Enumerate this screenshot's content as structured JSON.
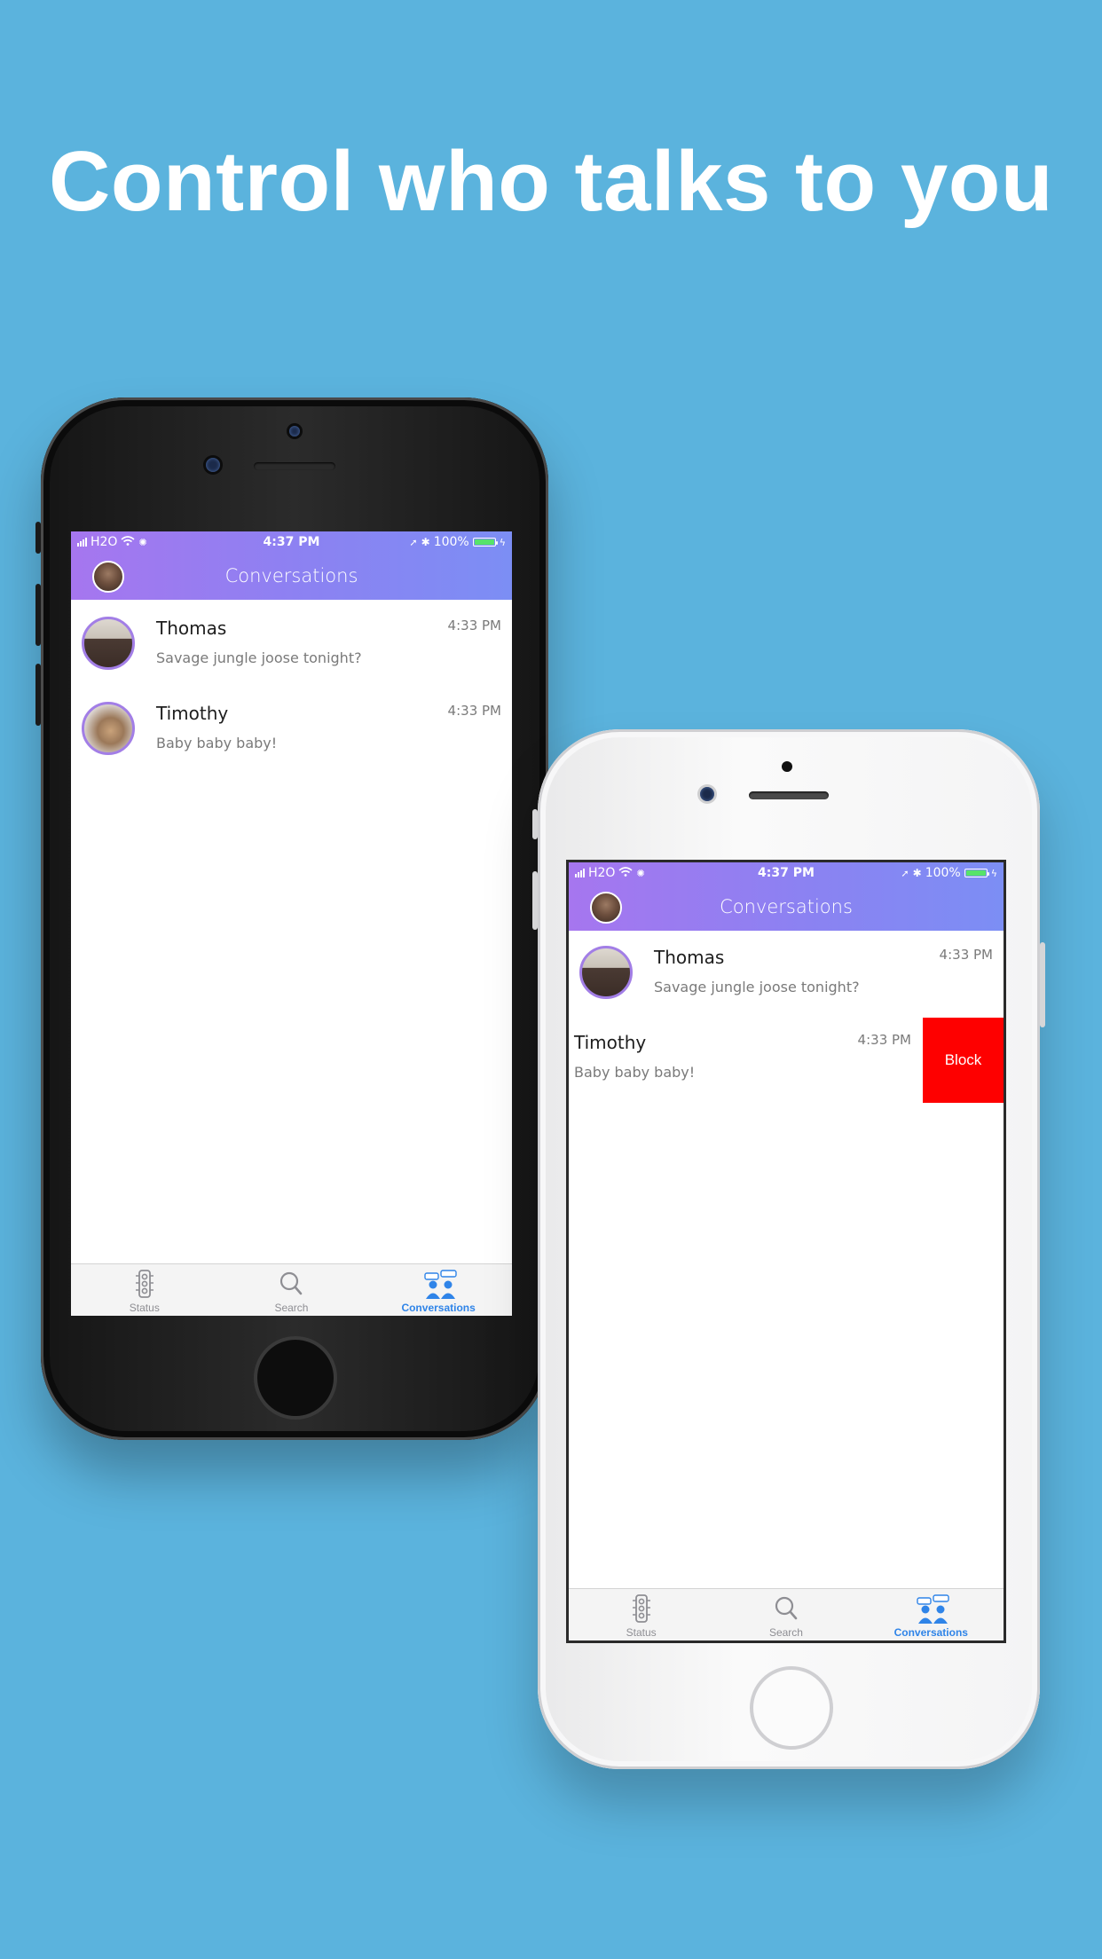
{
  "headline": "Control who talks to you",
  "status_bar": {
    "carrier": "H2O",
    "time": "4:37 PM",
    "battery": "100%",
    "battery_level": 1.0
  },
  "header": {
    "title": "Conversations"
  },
  "conversations": [
    {
      "name": "Thomas",
      "preview": "Savage jungle joose tonight?",
      "time": "4:33 PM"
    },
    {
      "name": "Timothy",
      "preview": "Baby baby baby!",
      "time": "4:33 PM"
    }
  ],
  "swipe_action": {
    "label": "Block",
    "color": "#fe0000"
  },
  "tabs": [
    {
      "label": "Status",
      "icon": "traffic-light-icon"
    },
    {
      "label": "Search",
      "icon": "search-icon"
    },
    {
      "label": "Conversations",
      "icon": "people-chat-icon",
      "active": true
    }
  ],
  "colors": {
    "background": "#5bb3dd",
    "header_gradient_start": "#a676ef",
    "header_gradient_end": "#7c8ef4",
    "active_tab": "#2f84e8",
    "avatar_ring": "#a27ee6"
  }
}
